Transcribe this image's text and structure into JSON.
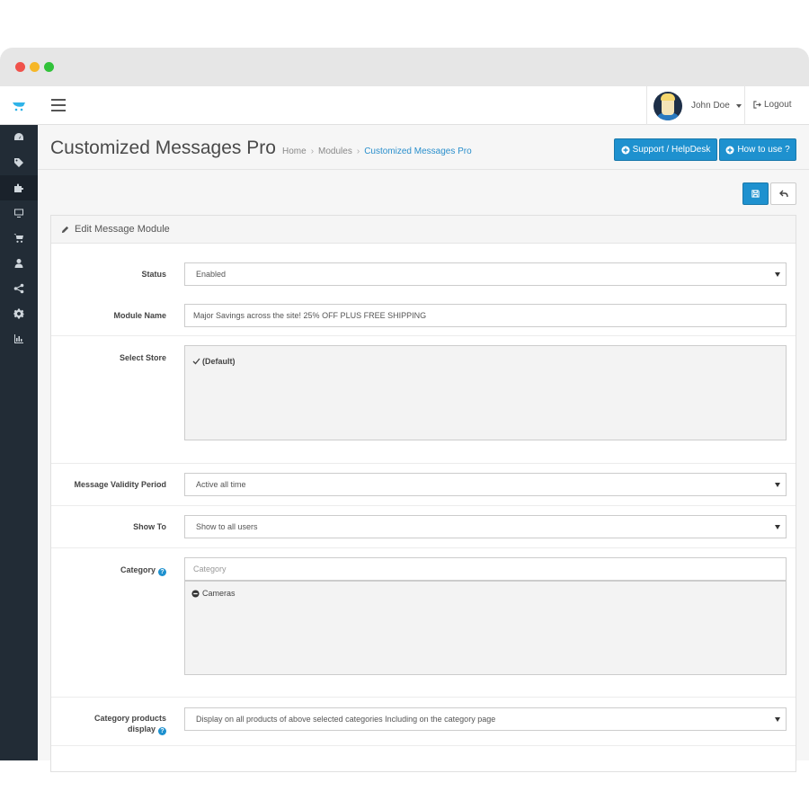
{
  "header": {
    "user_name": "John Doe",
    "logout_label": "Logout"
  },
  "sidebar": {
    "items": [
      {
        "icon": "dashboard-icon",
        "active": false
      },
      {
        "icon": "tags-icon",
        "active": false
      },
      {
        "icon": "puzzle-icon",
        "active": true
      },
      {
        "icon": "monitor-icon",
        "active": false
      },
      {
        "icon": "cart-icon",
        "active": false
      },
      {
        "icon": "user-icon",
        "active": false
      },
      {
        "icon": "share-icon",
        "active": false
      },
      {
        "icon": "gear-icon",
        "active": false
      },
      {
        "icon": "bar-chart-icon",
        "active": false
      }
    ]
  },
  "page": {
    "title": "Customized Messages Pro",
    "breadcrumb": [
      "Home",
      "Modules",
      "Customized Messages Pro"
    ],
    "support_label": "Support / HelpDesk",
    "howto_label": "How to use ?"
  },
  "panel": {
    "heading": "Edit Message Module"
  },
  "form": {
    "status": {
      "label": "Status",
      "value": "Enabled"
    },
    "module_name": {
      "label": "Module Name",
      "value": "Major Savings across the site! 25% OFF PLUS FREE SHIPPING"
    },
    "select_store": {
      "label": "Select Store",
      "store": "(Default)"
    },
    "validity": {
      "label": "Message Validity Period",
      "value": "Active all time"
    },
    "show_to": {
      "label": "Show To",
      "value": "Show to all users"
    },
    "category": {
      "label": "Category",
      "placeholder": "Category",
      "items": [
        "Cameras"
      ]
    },
    "category_products": {
      "label_line1": "Category products",
      "label_line2": "display",
      "value": "Display on all products of above selected categories Including on the category page"
    }
  },
  "colors": {
    "primary": "#1e91cf",
    "sidebar": "#222c36"
  }
}
